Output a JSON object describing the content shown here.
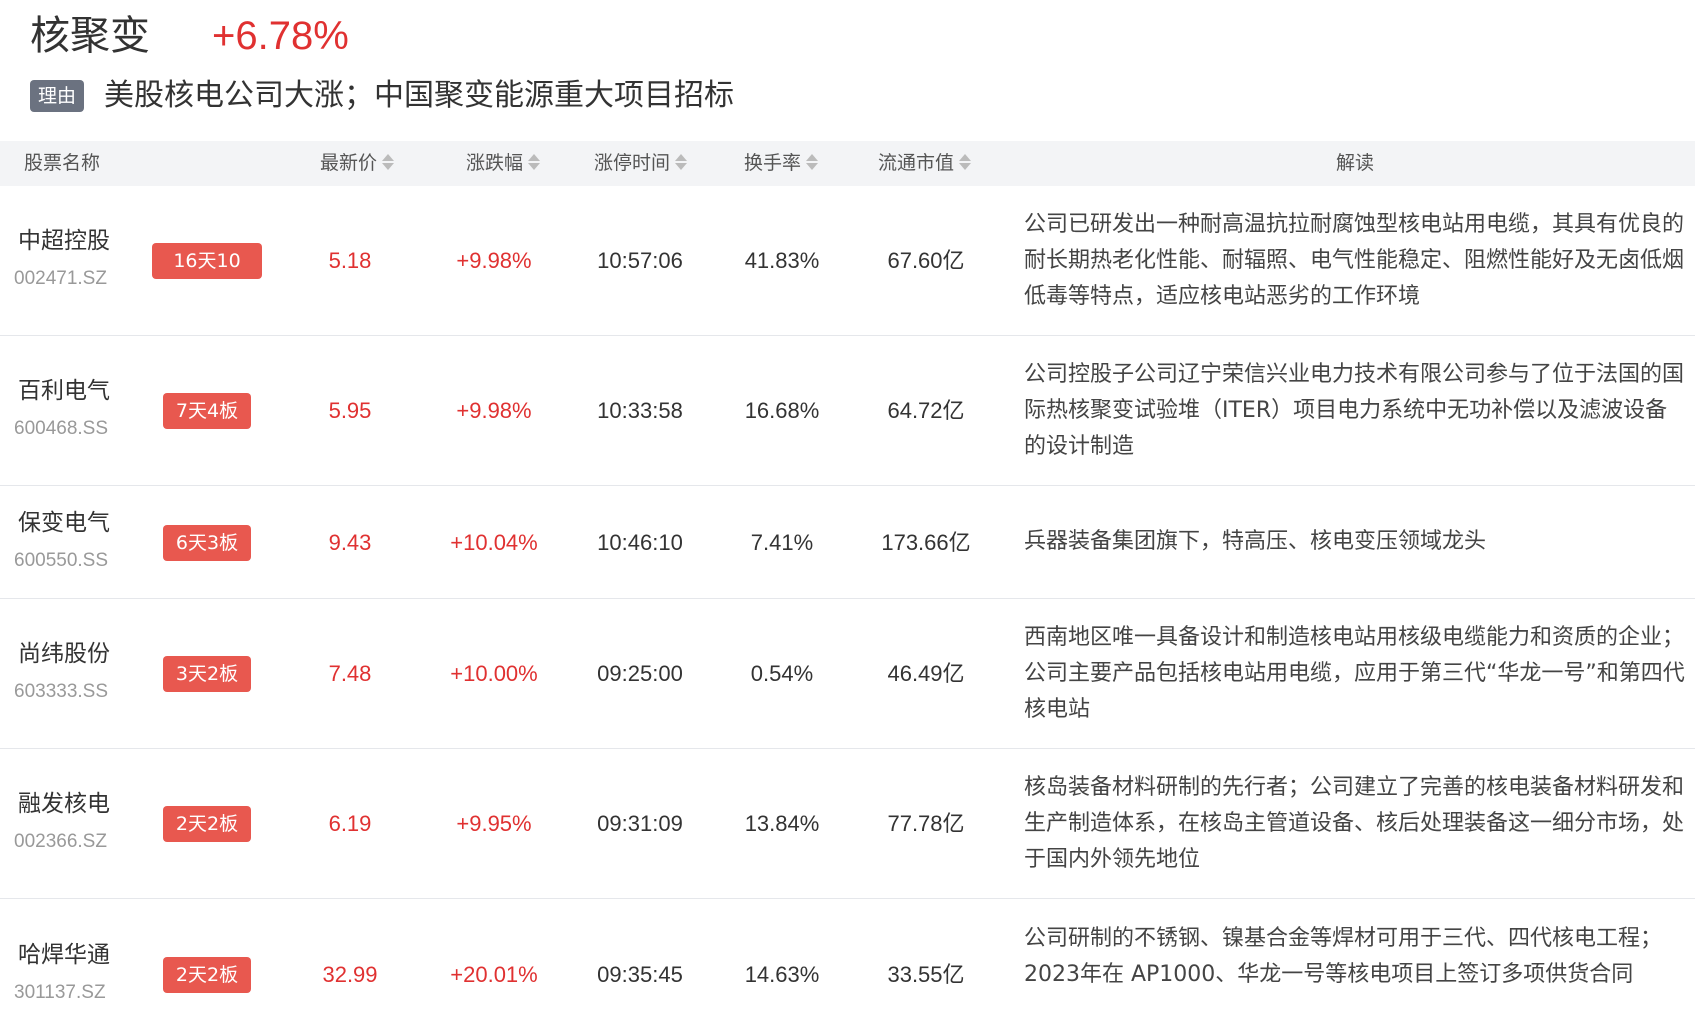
{
  "header": {
    "sector_name": "核聚变",
    "sector_change": "+6.78%",
    "reason_tag": "理由",
    "reason_text": "美股核电公司大涨；中国聚变能源重大项目招标"
  },
  "table": {
    "columns": {
      "name": "股票名称",
      "price": "最新价",
      "change": "涨跌幅",
      "limit_time": "涨停时间",
      "turnover": "换手率",
      "market_cap": "流通市值",
      "analysis": "解读"
    },
    "rows": [
      {
        "name": "中超控股",
        "code": "002471.SZ",
        "badge": "16天10板",
        "price": "5.18",
        "change": "+9.98%",
        "limit_time": "10:57:06",
        "turnover": "41.83%",
        "market_cap": "67.60亿",
        "analysis": "公司已研发出一种耐高温抗拉耐腐蚀型核电站用电缆，其具有优良的耐长期热老化性能、耐辐照、电气性能稳定、阻燃性能好及无卤低烟低毒等特点，适应核电站恶劣的工作环境"
      },
      {
        "name": "百利电气",
        "code": "600468.SS",
        "badge": "7天4板",
        "price": "5.95",
        "change": "+9.98%",
        "limit_time": "10:33:58",
        "turnover": "16.68%",
        "market_cap": "64.72亿",
        "analysis": "公司控股子公司辽宁荣信兴业电力技术有限公司参与了位于法国的国际热核聚变试验堆（ITER）项目电力系统中无功补偿以及滤波设备的设计制造"
      },
      {
        "name": "保变电气",
        "code": "600550.SS",
        "badge": "6天3板",
        "price": "9.43",
        "change": "+10.04%",
        "limit_time": "10:46:10",
        "turnover": "7.41%",
        "market_cap": "173.66亿",
        "analysis": "兵器装备集团旗下，特高压、核电变压领域龙头"
      },
      {
        "name": "尚纬股份",
        "code": "603333.SS",
        "badge": "3天2板",
        "price": "7.48",
        "change": "+10.00%",
        "limit_time": "09:25:00",
        "turnover": "0.54%",
        "market_cap": "46.49亿",
        "analysis": "西南地区唯一具备设计和制造核电站用核级电缆能力和资质的企业；公司主要产品包括核电站用电缆，应用于第三代“华龙一号”和第四代核电站"
      },
      {
        "name": "融发核电",
        "code": "002366.SZ",
        "badge": "2天2板",
        "price": "6.19",
        "change": "+9.95%",
        "limit_time": "09:31:09",
        "turnover": "13.84%",
        "market_cap": "77.78亿",
        "analysis": "核岛装备材料研制的先行者；公司建立了完善的核电装备材料研发和生产制造体系，在核岛主管道设备、核后处理装备这一细分市场，处于国内外领先地位"
      },
      {
        "name": "哈焊华通",
        "code": "301137.SZ",
        "badge": "2天2板",
        "price": "32.99",
        "change": "+20.01%",
        "limit_time": "09:35:45",
        "turnover": "14.63%",
        "market_cap": "33.55亿",
        "analysis": "公司研制的不锈钢、镍基合金等焊材可用于三代、四代核电工程；2023年在 AP1000、华龙一号等核电项目上签订多项供货合同"
      }
    ]
  },
  "colors": {
    "up_red": "#e03131",
    "badge_red": "#e8584f",
    "tag_gray": "#6b7280",
    "header_bg": "#f3f4f6"
  },
  "icons": {
    "sort": "sort-icon"
  }
}
